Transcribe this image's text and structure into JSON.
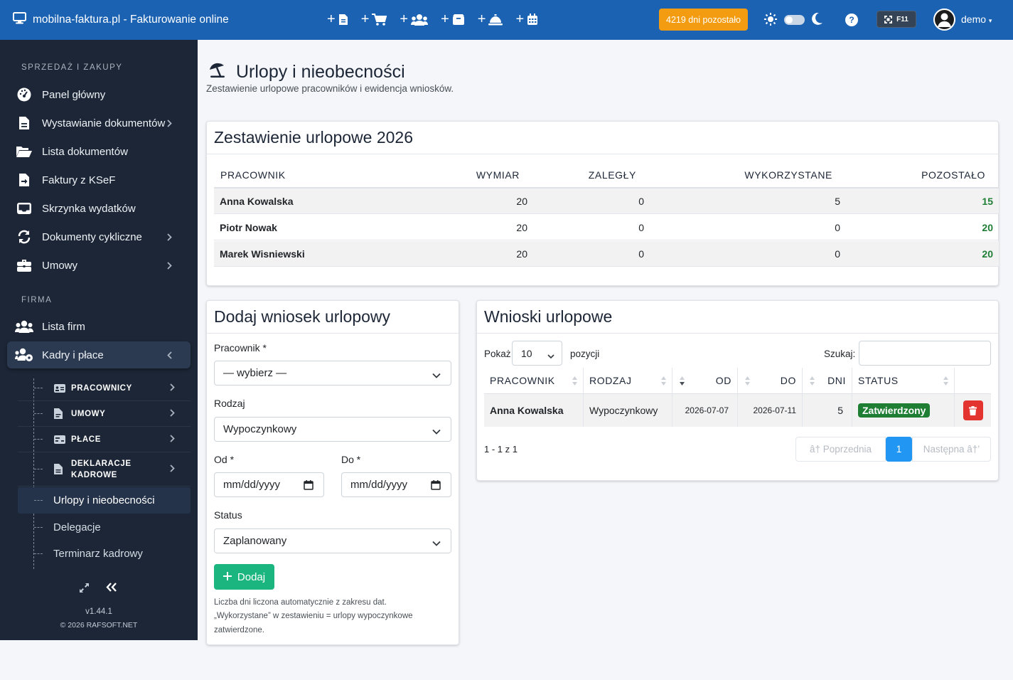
{
  "app": {
    "title": "mobilna-faktura.pl - Fakturowanie online",
    "days_left": "4219 dni pozostało",
    "f11": "F11",
    "help": "?",
    "user": "demo",
    "quick_actions": [
      "add-document",
      "add-cart",
      "add-users",
      "add-box",
      "add-vacation",
      "add-calendar"
    ]
  },
  "sidebar": {
    "section_sales": "SPRZEDAŻ I ZAKUPY",
    "section_company": "FIRMA",
    "items": [
      {
        "label": "Panel główny",
        "icon": "dashboard-icon"
      },
      {
        "label": "Wystawianie dokumentów",
        "icon": "file-icon"
      },
      {
        "label": "Lista dokumentów",
        "icon": "folder-icon"
      },
      {
        "label": "Faktury z KSeF",
        "icon": "file-import-icon"
      },
      {
        "label": "Skrzynka wydatków",
        "icon": "inbox-icon"
      },
      {
        "label": "Dokumenty cykliczne",
        "icon": "sync-icon"
      },
      {
        "label": "Umowy",
        "icon": "briefcase-icon"
      }
    ],
    "company_items": [
      {
        "label": "Lista firm",
        "icon": "users-icon"
      },
      {
        "label": "Kadry i płace",
        "icon": "users-cog-icon"
      }
    ],
    "sub_items": [
      {
        "label": "PRACOWNICY",
        "icon": "id-card-icon"
      },
      {
        "label": "UMOWY",
        "icon": "file-contract-icon"
      },
      {
        "label": "PŁACE",
        "icon": "money-icon"
      },
      {
        "label": "DEKLARACJE KADROWE",
        "icon": "file-text-icon"
      }
    ],
    "leaves": [
      "Urlopy i nieobecności",
      "Delegacje",
      "Terminarz kadrowy"
    ],
    "version": "v1.44.1",
    "copyright": "© 2026 RAFSOFT.NET"
  },
  "page": {
    "title": "Urlopy i nieobecności",
    "subtitle": "Zestawienie urlopowe pracowników i ewidencja wniosków."
  },
  "summary": {
    "title": "Zestawienie urlopowe 2026",
    "headers": [
      "PRACOWNIK",
      "WYMIAR",
      "ZALEGŁY",
      "WYKORZYSTANE",
      "POZOSTAŁO"
    ],
    "rows": [
      {
        "name": "Anna Kowalska",
        "wymiar": "20",
        "zalegly": "0",
        "wykorzystane": "5",
        "pozostalo": "15"
      },
      {
        "name": "Piotr Nowak",
        "wymiar": "20",
        "zalegly": "0",
        "wykorzystane": "0",
        "pozostalo": "20"
      },
      {
        "name": "Marek Wisniewski",
        "wymiar": "20",
        "zalegly": "0",
        "wykorzystane": "0",
        "pozostalo": "20"
      }
    ]
  },
  "form": {
    "title": "Dodaj wniosek urlopowy",
    "employee_label": "Pracownik *",
    "employee_value": "— wybierz —",
    "type_label": "Rodzaj",
    "type_value": "Wypoczynkowy",
    "from_label": "Od *",
    "to_label": "Do *",
    "date_placeholder": "mm/dd/yyyy",
    "status_label": "Status",
    "status_value": "Zaplanowany",
    "submit": "Dodaj",
    "note_1": "Liczba dni liczona automatycznie z zakresu dat.",
    "note_2": "„Wykorzystane” w zestawieniu = urlopy wypoczynkowe",
    "note_3": "zatwierdzone."
  },
  "requests": {
    "title": "Wnioski urlopowe",
    "show": "Pokaż",
    "page_length": "10",
    "entries": "pozycji",
    "search_label": "Szukaj:",
    "search_value": "",
    "headers": [
      "PRACOWNIK",
      "RODZAJ",
      "OD",
      "DO",
      "DNI",
      "STATUS"
    ],
    "rows": [
      {
        "name": "Anna Kowalska",
        "type": "Wypoczynkowy",
        "from": "2026-07-07",
        "to": "2026-07-11",
        "days": "5",
        "status": "Zatwierdzony"
      }
    ],
    "info": "1 - 1 z 1",
    "prev": "â† Poprzednia",
    "current_page": "1",
    "next": "Następna â†’"
  },
  "colors": {
    "topbar": "#1b62b3",
    "sidebar": "#1c2636",
    "badge_orange": "#f39c12",
    "success": "#1bb580",
    "status_green": "#1e7e34",
    "danger": "#e3342f",
    "pager_active": "#2196f3"
  }
}
